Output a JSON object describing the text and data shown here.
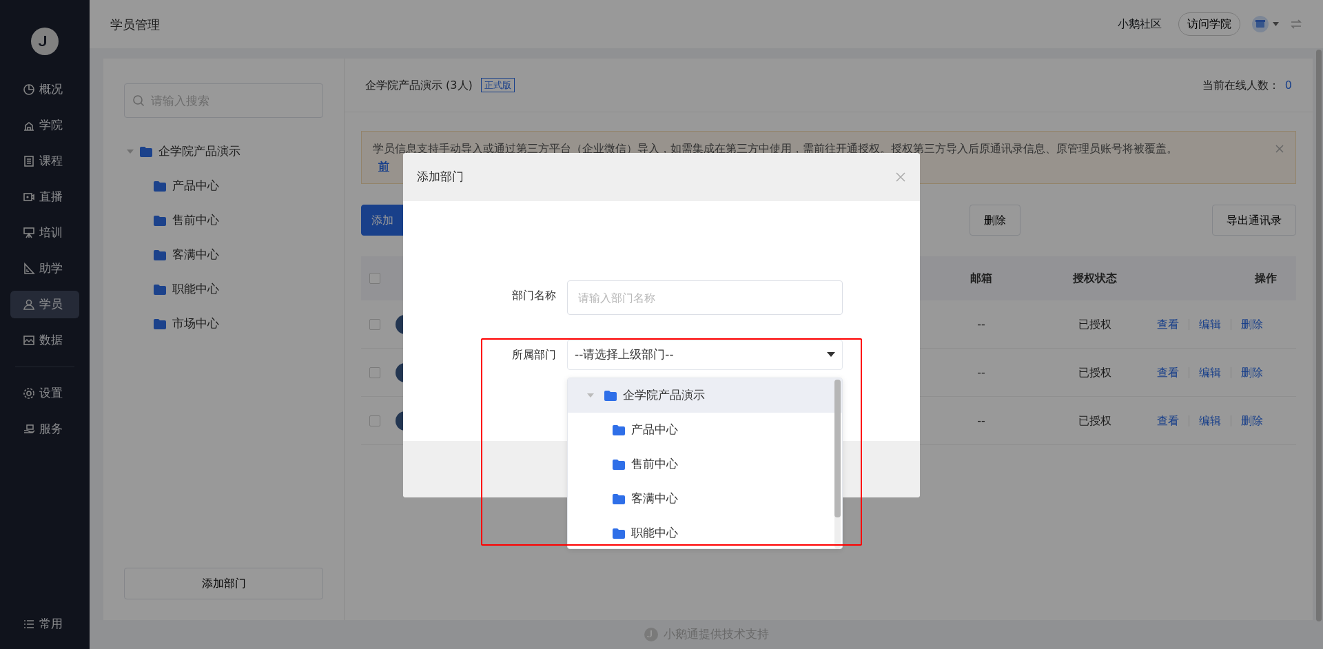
{
  "sidebar": {
    "groups": [
      {
        "items": [
          {
            "label": "概况",
            "selected": false
          },
          {
            "label": "学院",
            "selected": false
          },
          {
            "label": "课程",
            "selected": false
          },
          {
            "label": "直播",
            "selected": false
          },
          {
            "label": "培训",
            "selected": false
          },
          {
            "label": "助学",
            "selected": false
          },
          {
            "label": "学员",
            "selected": true
          },
          {
            "label": "数据",
            "selected": false
          }
        ]
      },
      {
        "items": [
          {
            "label": "设置",
            "selected": false
          },
          {
            "label": "服务",
            "selected": false
          }
        ]
      }
    ],
    "bottom_item": {
      "label": "常用"
    }
  },
  "topbar": {
    "title": "学员管理",
    "community_link": "小鹅社区",
    "visit_button": "访问学院"
  },
  "tree": {
    "search_placeholder": "请输入搜索",
    "root": {
      "label": "企学院产品演示",
      "expanded": true,
      "children": [
        {
          "label": "产品中心"
        },
        {
          "label": "售前中心"
        },
        {
          "label": "客满中心"
        },
        {
          "label": "职能中心"
        },
        {
          "label": "市场中心"
        }
      ]
    },
    "add_button": "添加部门"
  },
  "main": {
    "title": "企学院产品演示 (3人)",
    "edition_badge": "正式版",
    "online_label": "当前在线人数：",
    "online_count": "0",
    "alert": {
      "text": "学员信息支持手动导入或通过第三方平台（企业微信）导入，如需集成在第三方中使用，需前往开通授权。授权第三方导入后原通讯录信息、原管理员账号将被覆盖。",
      "link": "前"
    },
    "buttons": [
      {
        "kind": "primary",
        "label": "添加"
      },
      {
        "kind": "plain",
        "label": "删除"
      },
      {
        "kind": "plain",
        "label": "导出通讯录"
      }
    ],
    "table": {
      "all_checked": false,
      "columns": [
        "邮箱",
        "授权状态",
        "操作"
      ],
      "rows": [
        {
          "checked": false,
          "email": "--",
          "status": "已授权",
          "actions": [
            "查看",
            "编辑",
            "删除"
          ]
        },
        {
          "checked": false,
          "email": "--",
          "status": "已授权",
          "actions": [
            "查看",
            "编辑",
            "删除"
          ]
        },
        {
          "checked": false,
          "email": "--",
          "status": "已授权",
          "actions": [
            "查看",
            "编辑",
            "删除"
          ]
        }
      ]
    }
  },
  "modal": {
    "title": "添加部门",
    "fields": [
      {
        "kind": "input",
        "label": "部门名称",
        "placeholder": "请输入部门名称"
      },
      {
        "kind": "select",
        "label": "所属部门",
        "value": "--请选择上级部门--"
      }
    ],
    "dropdown": {
      "root": {
        "label": "企学院产品演示",
        "expanded": true,
        "selected": true,
        "children": [
          {
            "label": "产品中心",
            "selected": false
          },
          {
            "label": "售前中心",
            "selected": false
          },
          {
            "label": "客满中心",
            "selected": false
          },
          {
            "label": "职能中心",
            "selected": false
          }
        ]
      }
    }
  },
  "footer": {
    "text": "小鹅通提供技术支持"
  }
}
